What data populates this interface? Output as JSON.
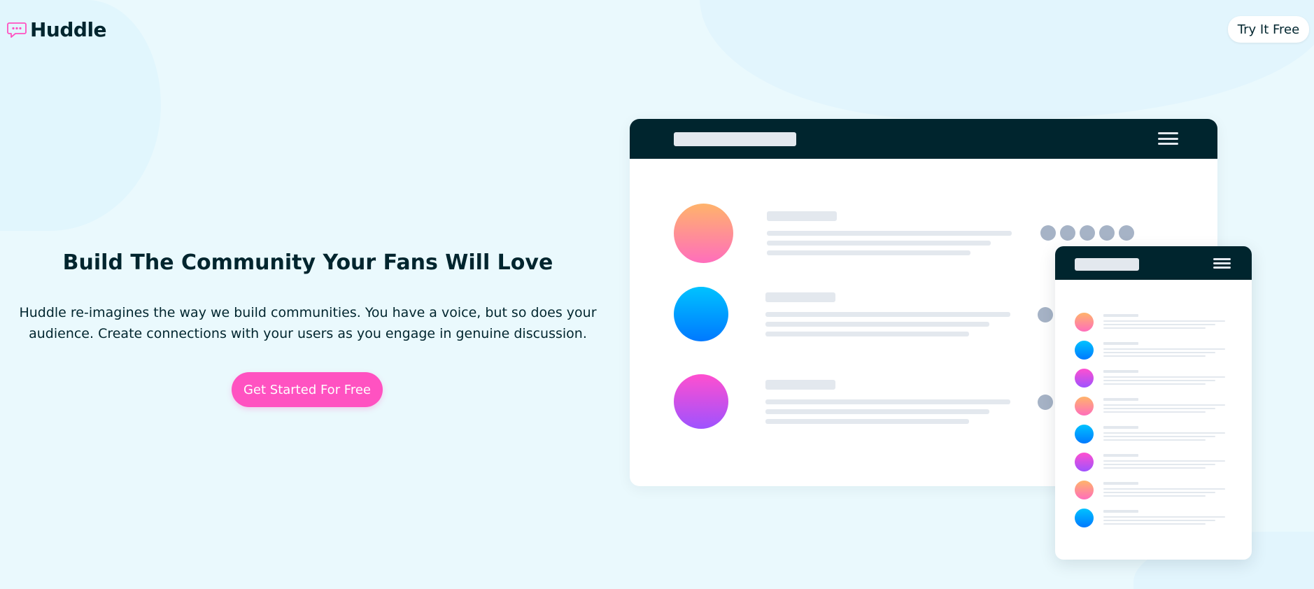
{
  "brand": {
    "name": "Huddle",
    "accent": "#ff52c1",
    "dark": "#00252e"
  },
  "header": {
    "try_button": "Try It Free"
  },
  "hero": {
    "title": "Build The Community Your Fans Will Love",
    "description": "Huddle re-imagines the way we build communities. You have a voice, but so does your audience. Create connections with your users as you engage in genuine discussion.",
    "cta_label": "Get Started For Free"
  },
  "mockup": {
    "desktop_rows": [
      "orange",
      "blue",
      "purple"
    ],
    "phone_rows": [
      "orange",
      "blue",
      "purple",
      "orange",
      "blue",
      "purple",
      "orange",
      "blue"
    ],
    "icons": [
      "menu-icon",
      "chat-bubble-icon"
    ]
  }
}
